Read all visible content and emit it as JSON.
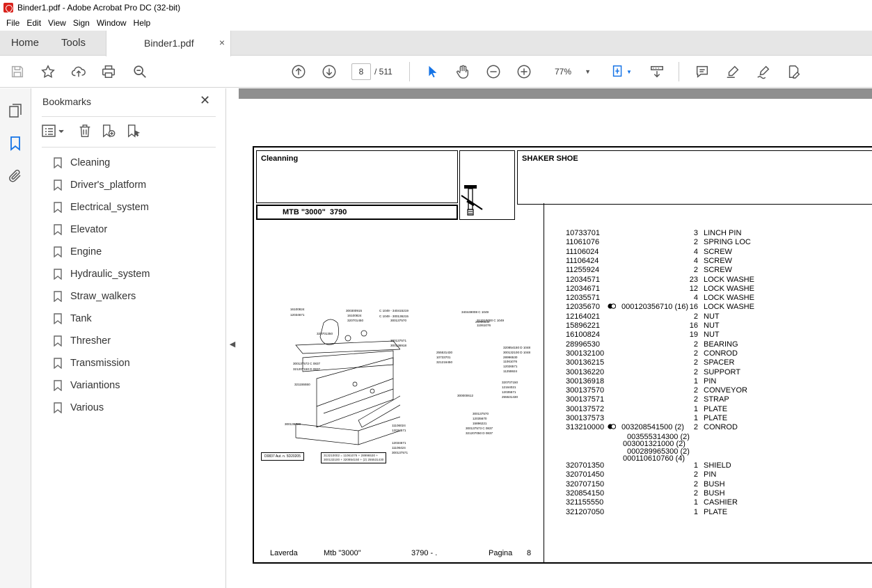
{
  "window": {
    "title": "Binder1.pdf - Adobe Acrobat Pro DC (32-bit)"
  },
  "menu": [
    "File",
    "Edit",
    "View",
    "Sign",
    "Window",
    "Help"
  ],
  "tabs": {
    "home": "Home",
    "tools": "Tools",
    "document": "Binder1.pdf",
    "close": "×"
  },
  "toolbar": {
    "page_current": "8",
    "page_total": "/ 511",
    "zoom": "77%"
  },
  "bookmarks": {
    "title": "Bookmarks",
    "close": "✕",
    "items": [
      "Cleaning",
      "Driver's_platform",
      "Electrical_system",
      "Elevator",
      "Engine",
      "Hydraulic_system",
      "Straw_walkers",
      "Tank",
      "Thresher",
      "Transmission",
      "Variantions",
      "Various"
    ]
  },
  "pdf": {
    "section": "Cleanning",
    "model": "MTB \"3000\"  3790",
    "group": "SHAKER SHOE",
    "footer": {
      "brand": "Laverda",
      "model": "Mtb \"3000\"",
      "code": "3790 - .",
      "page_label": "Pagina",
      "page": "8"
    },
    "parts": [
      {
        "code": "10733701",
        "qty": "3",
        "desc": "LINCH PIN"
      },
      {
        "code": "11061076",
        "qty": "2",
        "desc": "SPRING LOC"
      },
      {
        "code": "11106024",
        "qty": "4",
        "desc": "SCREW"
      },
      {
        "code": "11106424",
        "qty": "4",
        "desc": "SCREW"
      },
      {
        "code": "11255924",
        "qty": "2",
        "desc": "SCREW"
      },
      {
        "code": "12034571",
        "qty": "23",
        "desc": "LOCK WASHE"
      },
      {
        "code": "12034671",
        "qty": "12",
        "desc": "LOCK WASHE"
      },
      {
        "code": "12035571",
        "qty": "4",
        "desc": "LOCK WASHE"
      },
      {
        "code": "12035670",
        "qty": "16",
        "desc": "LOCK WASHE",
        "alt": "000120356710  (16)"
      },
      {
        "code": "12164021",
        "qty": "2",
        "desc": "NUT"
      },
      {
        "code": "15896221",
        "qty": "16",
        "desc": "NUT"
      },
      {
        "code": "16100824",
        "qty": "19",
        "desc": "NUT"
      },
      {
        "code": "28996530",
        "qty": "2",
        "desc": "BEARING"
      },
      {
        "code": "300132100",
        "qty": "2",
        "desc": "CONROD"
      },
      {
        "code": "300136215",
        "qty": "2",
        "desc": "SPACER"
      },
      {
        "code": "300136220",
        "qty": "2",
        "desc": "SUPPORT"
      },
      {
        "code": "300136918",
        "qty": "1",
        "desc": "PIN"
      },
      {
        "code": "300137570",
        "qty": "2",
        "desc": "CONVEYOR"
      },
      {
        "code": "300137571",
        "qty": "2",
        "desc": "STRAP"
      },
      {
        "code": "300137572",
        "qty": "1",
        "desc": "PLATE"
      },
      {
        "code": "300137573",
        "qty": "1",
        "desc": "PLATE"
      },
      {
        "code": "313210000",
        "qty": "2",
        "desc": "CONROD",
        "alt": "003208541500  (2)"
      }
    ],
    "subparts": [
      "003555314300  (2)",
      "003001321000  (2)",
      "000289965300  (2)",
      "000110610760  (4)"
    ],
    "parts2": [
      {
        "code": "320701350",
        "qty": "1",
        "desc": "SHIELD"
      },
      {
        "code": "320701450",
        "qty": "2",
        "desc": "PIN"
      },
      {
        "code": "320707150",
        "qty": "2",
        "desc": "BUSH"
      },
      {
        "code": "320854150",
        "qty": "2",
        "desc": "BUSH"
      },
      {
        "code": "321155550",
        "qty": "1",
        "desc": "CASHIER"
      },
      {
        "code": "321207050",
        "qty": "1",
        "desc": "PLATE"
      }
    ],
    "diagram_labels": {
      "l1": "16100824",
      "l2": "12034671",
      "l3": "300300915",
      "l4": "16100824",
      "l5": "320701450",
      "l6": "320701350",
      "l7": "C 1049 - 340415219",
      "l8": "C 1049 - 300136215",
      "l9": "300137570",
      "l10": "300137571",
      "l11": "300136918",
      "l12": "340449008 C 1049",
      "l13": "28996530",
      "l14": "313210000 C 1049",
      "l15": "11061076",
      "l16": "300137572 C 0837",
      "l17": "321207150 D 0837",
      "l18": "321155550",
      "l19": "255531430",
      "l20": "10733701",
      "l21": "321216450",
      "l22": "320854150 D 1048",
      "l23": "300132100 D 1048",
      "l24": "28996530",
      "l25": "11061076",
      "l26": "12026571",
      "l27": "11255924",
      "l28": "320707150",
      "l29": "12164021",
      "l30": "12035571",
      "l31": "255531430",
      "l32": "300000612",
      "l33": "300137570",
      "l34": "12035670",
      "l35": "15896221",
      "l36": "300137573 C 0837",
      "l37": "321207050 D 0837",
      "l38": "300136220",
      "l39": "11106024",
      "l40": "12034571",
      "l41": "12034671",
      "l42": "11106424",
      "l43": "300137571",
      "stamp": "D0837 Aut. n. 5D20205",
      "kit1": "313210002 = 11061076 + 28996530 +",
      "kit2": "300132100 + 320854150 + (2) 255531430"
    }
  }
}
